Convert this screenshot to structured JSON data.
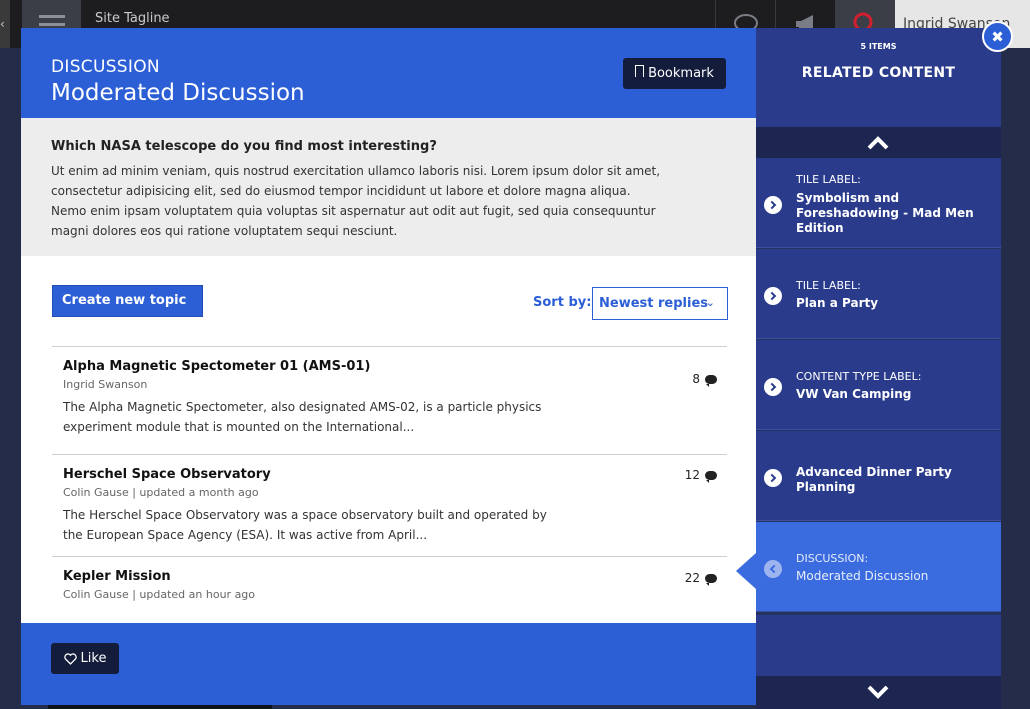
{
  "site": {
    "tagline": "Site Tagline",
    "user_name": "Ingrid Swanson",
    "icons": [
      "hamburger-icon",
      "chat-icon",
      "megaphone-icon",
      "search-icon"
    ]
  },
  "modal": {
    "kicker": "DISCUSSION",
    "title": "Moderated Discussion",
    "bookmark_label": "Bookmark",
    "question": "Which NASA telescope do you find most interesting?",
    "description": "Ut enim ad minim veniam, quis nostrud exercitation ullamco laboris nisi. Lorem ipsum dolor sit amet, consectetur adipisicing elit, sed do eiusmod tempor incididunt ut labore et dolore magna aliqua. Nemo enim ipsam voluptatem quia voluptas sit aspernatur aut odit aut fugit, sed quia consequuntur magni dolores eos qui ratione voluptatem sequi nesciunt.",
    "create_topic_label": "Create new topic",
    "sort_label": "Sort by:",
    "sort_value": "Newest replies",
    "topics": [
      {
        "title": "Alpha Magnetic Spectometer 01 (AMS-01)",
        "meta": "Ingrid Swanson",
        "desc": "The Alpha Magnetic Spectometer, also designated AMS-02, is a particle physics experiment module that is mounted on the International...",
        "count": "8"
      },
      {
        "title": "Herschel Space Observatory",
        "meta": "Colin Gause | updated a month ago",
        "desc": "The Herschel Space Observatory was a space observatory built and operated by the European Space Agency (ESA). It was active from April...",
        "count": "12"
      },
      {
        "title": "Kepler Mission",
        "meta": "Colin Gause | updated an hour ago",
        "desc": "",
        "count": "22"
      }
    ],
    "like_label": "Like"
  },
  "related": {
    "count_label": "5 ITEMS",
    "title": "RELATED CONTENT",
    "items": [
      {
        "label": "TILE LABEL:",
        "text": "Symbolism and Foreshadowing - Mad Men Edition"
      },
      {
        "label": "TILE LABEL:",
        "text": "Plan a Party"
      },
      {
        "label": "CONTENT TYPE LABEL:",
        "text": "VW Van Camping"
      },
      {
        "label": "",
        "text": "Advanced Dinner Party Planning"
      },
      {
        "label": "DISCUSSION:",
        "text": "Moderated Discussion"
      }
    ]
  },
  "colors": {
    "accent": "#2c5fd6",
    "dark_button": "#141c3c",
    "sidebar": "#2a3b8c",
    "active_item": "#3b6cdf"
  }
}
